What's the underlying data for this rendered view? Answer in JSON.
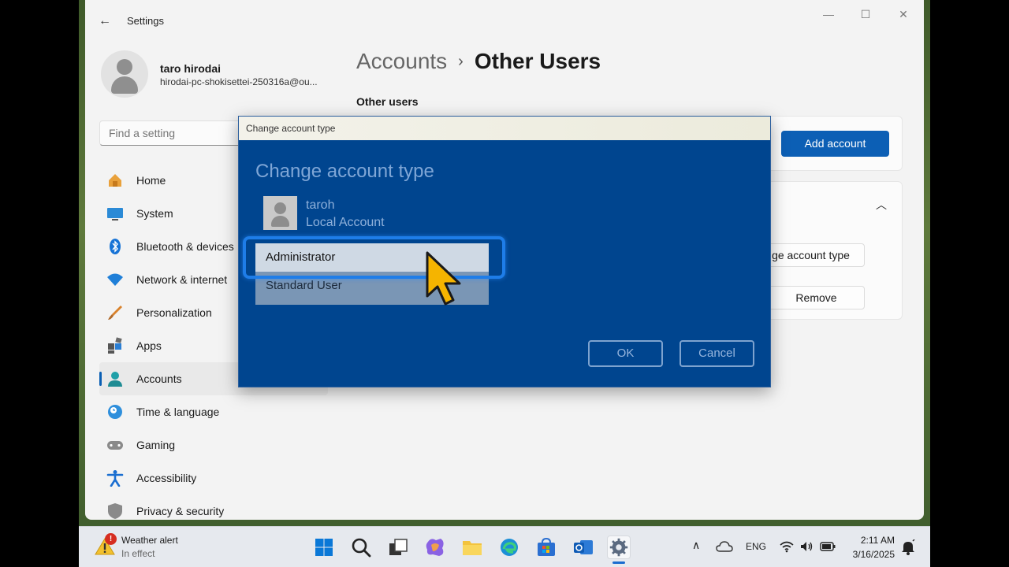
{
  "window": {
    "title": "Settings",
    "back_icon": "back-arrow-icon"
  },
  "profile": {
    "name": "taro hirodai",
    "email": "hirodai-pc-shokisettei-250316a@ou..."
  },
  "search": {
    "placeholder": "Find a setting"
  },
  "sidebar": {
    "items": [
      {
        "label": "Home",
        "icon": "home-icon"
      },
      {
        "label": "System",
        "icon": "system-icon"
      },
      {
        "label": "Bluetooth & devices",
        "icon": "bluetooth-icon"
      },
      {
        "label": "Network & internet",
        "icon": "wifi-icon"
      },
      {
        "label": "Personalization",
        "icon": "brush-icon"
      },
      {
        "label": "Apps",
        "icon": "apps-icon"
      },
      {
        "label": "Accounts",
        "icon": "accounts-icon",
        "active": true
      },
      {
        "label": "Time & language",
        "icon": "clock-globe-icon"
      },
      {
        "label": "Gaming",
        "icon": "gamepad-icon"
      },
      {
        "label": "Accessibility",
        "icon": "accessibility-icon"
      },
      {
        "label": "Privacy & security",
        "icon": "shield-icon"
      }
    ]
  },
  "main": {
    "breadcrumb_parent": "Accounts",
    "breadcrumb_separator": "›",
    "breadcrumb_current": "Other Users",
    "section_label": "Other users",
    "add_account_label": "Add account",
    "change_type_label": "ge account type",
    "remove_label": "Remove"
  },
  "dialog": {
    "title": "Change account type",
    "heading": "Change account type",
    "user_name": "taroh",
    "user_type": "Local Account",
    "options": [
      "Administrator",
      "Standard User"
    ],
    "selected_option": "Administrator",
    "ok_label": "OK",
    "cancel_label": "Cancel"
  },
  "taskbar": {
    "weather_title": "Weather alert",
    "weather_subtitle": "In effect",
    "weather_badge": "!",
    "language": "ENG",
    "time": "2:11 AM",
    "date": "3/16/2025"
  },
  "colors": {
    "accent": "#0c5fb5",
    "dialog_bg": "#00458f",
    "highlight": "#1e7de8",
    "cursor": "#f5b400"
  }
}
